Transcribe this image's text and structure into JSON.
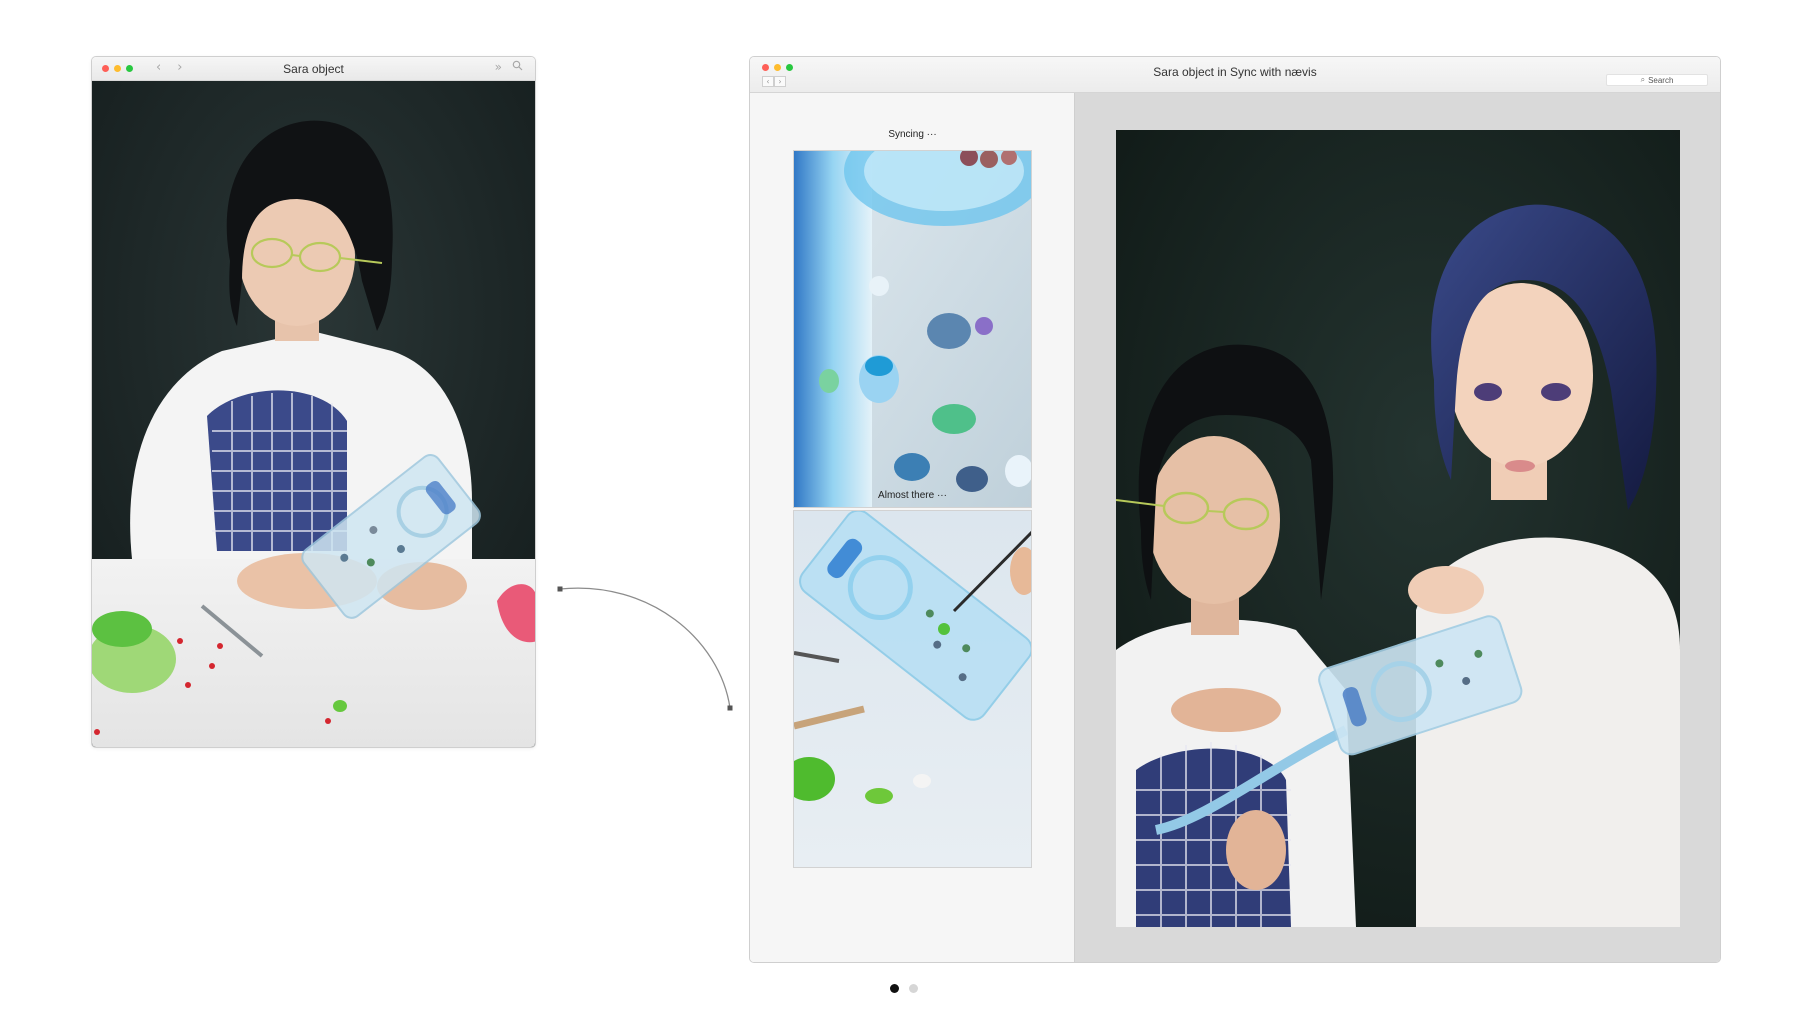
{
  "left_window": {
    "title": "Sara object",
    "nav_back": "‹",
    "nav_forward": "›",
    "icons": [
      "chevron-double-right-icon",
      "search-icon"
    ]
  },
  "right_window": {
    "title": "Sara object in Sync with nævis",
    "nav_back": "‹",
    "nav_forward": "›",
    "search_label": "Search",
    "sidebar": {
      "items": [
        {
          "caption": "Syncing ···"
        },
        {
          "caption": "Almost there ···"
        }
      ]
    }
  },
  "pager": {
    "count": 2,
    "active_index": 0
  },
  "colors": {
    "traffic_red": "#fe5f57",
    "traffic_yellow": "#febc2e",
    "traffic_green": "#28c840",
    "sidebar_bg": "#f6f6f6",
    "main_bg": "#d9d9d9"
  }
}
